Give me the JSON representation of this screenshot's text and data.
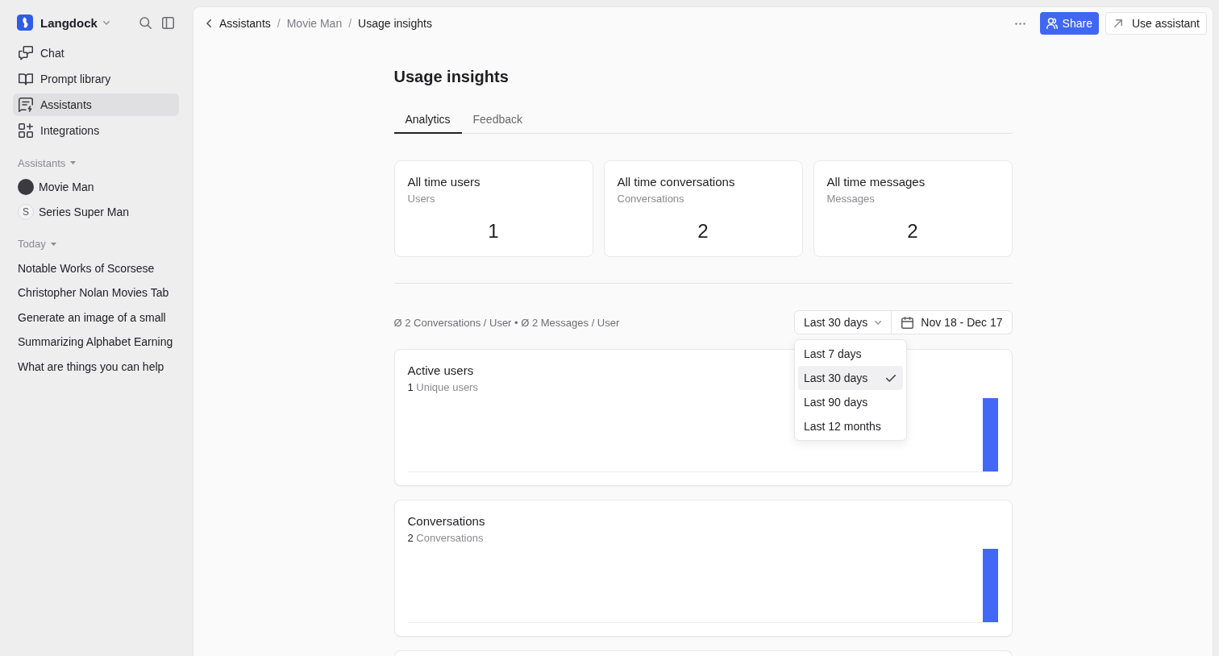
{
  "sidebar": {
    "workspace": "Langdock",
    "nav": [
      {
        "label": "Chat",
        "selected": false
      },
      {
        "label": "Prompt library",
        "selected": false
      },
      {
        "label": "Assistants",
        "selected": true
      },
      {
        "label": "Integrations",
        "selected": false
      }
    ],
    "sections": [
      {
        "title": "Assistants",
        "items": [
          {
            "kind": "photo",
            "label": "Movie Man"
          },
          {
            "kind": "letter",
            "letter": "S",
            "label": "Series Super Man"
          }
        ]
      },
      {
        "title": "Today",
        "items": [
          {
            "kind": "chat",
            "label": "Notable Works of Scorsese"
          },
          {
            "kind": "chat",
            "label": "Christopher Nolan Movies Tab"
          },
          {
            "kind": "chat",
            "label": "Generate an image of a small"
          },
          {
            "kind": "chat",
            "label": "Summarizing Alphabet Earning"
          },
          {
            "kind": "chat",
            "label": "What are things you can help"
          }
        ]
      }
    ]
  },
  "header": {
    "breadcrumb": {
      "separator": "/",
      "items": [
        {
          "label": "Assistants",
          "muted": false
        },
        {
          "label": "Movie Man",
          "muted": true
        },
        {
          "label": "Usage insights",
          "muted": false
        }
      ]
    },
    "buttons": [
      {
        "kind": "primary",
        "label": "Share"
      },
      {
        "kind": "secondary",
        "label": "Use assistant"
      }
    ]
  },
  "page": {
    "title": "Usage insights",
    "tabs": [
      {
        "label": "Analytics",
        "selected": true
      },
      {
        "label": "Feedback",
        "selected": false
      }
    ],
    "stats": [
      {
        "title": "All time users",
        "subtitle": "Users",
        "value": "1"
      },
      {
        "title": "All time conversations",
        "subtitle": "Conversations",
        "value": "2"
      },
      {
        "title": "All time messages",
        "subtitle": "Messages",
        "value": "2"
      }
    ],
    "summary": "Ø 2 Conversations / User • Ø 2 Messages / User",
    "range": {
      "value": "Last 30 days",
      "dates": "Nov 18 - Dec 17",
      "expanded": true,
      "options": [
        {
          "label": "Last 7 days",
          "selected": false
        },
        {
          "label": "Last 30 days",
          "selected": true
        },
        {
          "label": "Last 90 days",
          "selected": false
        },
        {
          "label": "Last 12 months",
          "selected": false
        }
      ]
    },
    "charts": [
      {
        "title": "Active users",
        "count": "1",
        "unit": "Unique users"
      },
      {
        "title": "Conversations",
        "count": "2",
        "unit": "Conversations"
      }
    ]
  }
}
